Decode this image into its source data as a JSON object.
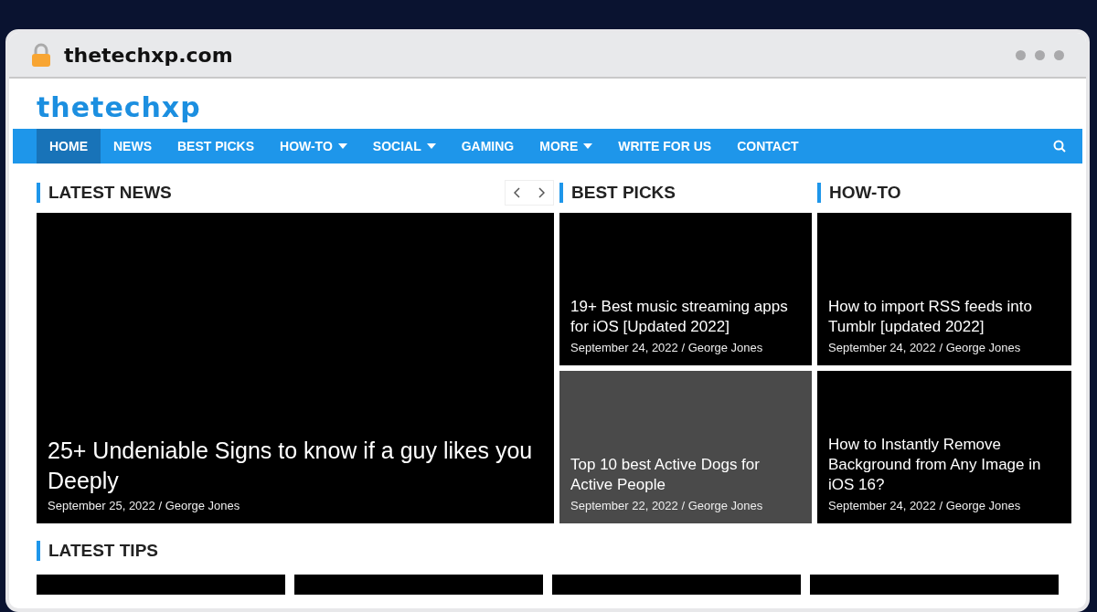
{
  "browser": {
    "url": "thetechxp.com"
  },
  "site": {
    "logo": "thetechxp"
  },
  "nav": [
    {
      "label": "HOME",
      "selected": true,
      "dropdown": false
    },
    {
      "label": "NEWS",
      "selected": false,
      "dropdown": false
    },
    {
      "label": "BEST PICKS",
      "selected": false,
      "dropdown": false
    },
    {
      "label": "HOW-TO",
      "selected": false,
      "dropdown": true
    },
    {
      "label": "SOCIAL",
      "selected": false,
      "dropdown": true
    },
    {
      "label": "GAMING",
      "selected": false,
      "dropdown": false
    },
    {
      "label": "MORE",
      "selected": false,
      "dropdown": true
    },
    {
      "label": "WRITE FOR US",
      "selected": false,
      "dropdown": false
    },
    {
      "label": "CONTACT",
      "selected": false,
      "dropdown": false
    }
  ],
  "latest_news": {
    "title": "LATEST NEWS",
    "post": {
      "title": "25+ Undeniable Signs to know if a guy likes you Deeply",
      "meta": "September 25, 2022 / George Jones"
    }
  },
  "columns": [
    {
      "title": "BEST PICKS",
      "posts": [
        {
          "title": "19+ Best music streaming apps for iOS [Updated 2022]",
          "meta": "September 24, 2022 / George Jones",
          "color": "#000000"
        },
        {
          "title": "Top 10 best Active Dogs for Active People",
          "meta": "September 22, 2022 / George Jones",
          "color": "#4a4a4a"
        }
      ]
    },
    {
      "title": "HOW-TO",
      "posts": [
        {
          "title": "How to import RSS feeds into Tumblr [updated 2022]",
          "meta": "September 24, 2022 / George Jones",
          "color": "#000000"
        },
        {
          "title": "How to Instantly Remove Background from Any Image in iOS 16?",
          "meta": "September 24, 2022 / George Jones",
          "color": "#000000"
        }
      ]
    }
  ],
  "latest_tips": {
    "title": "LATEST TIPS"
  }
}
